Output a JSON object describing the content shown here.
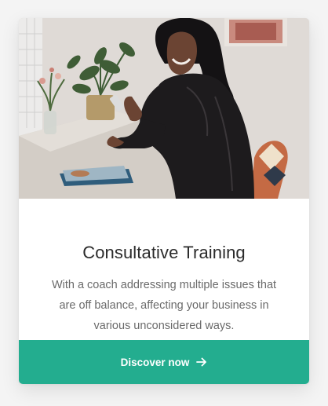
{
  "card": {
    "image_alt": "Woman smiling at her phone at a desk",
    "title": "Consultative Training",
    "description": "With a coach addressing multiple issues that are off balance, affecting your business in various unconsidered ways.",
    "cta_label": "Discover now",
    "cta_icon": "arrow-right-icon"
  },
  "colors": {
    "page_background": "#f4f4f4",
    "card_background": "#ffffff",
    "accent": "#23ad8f",
    "title": "#2b2b2b",
    "body_text": "#6a6a6a"
  }
}
